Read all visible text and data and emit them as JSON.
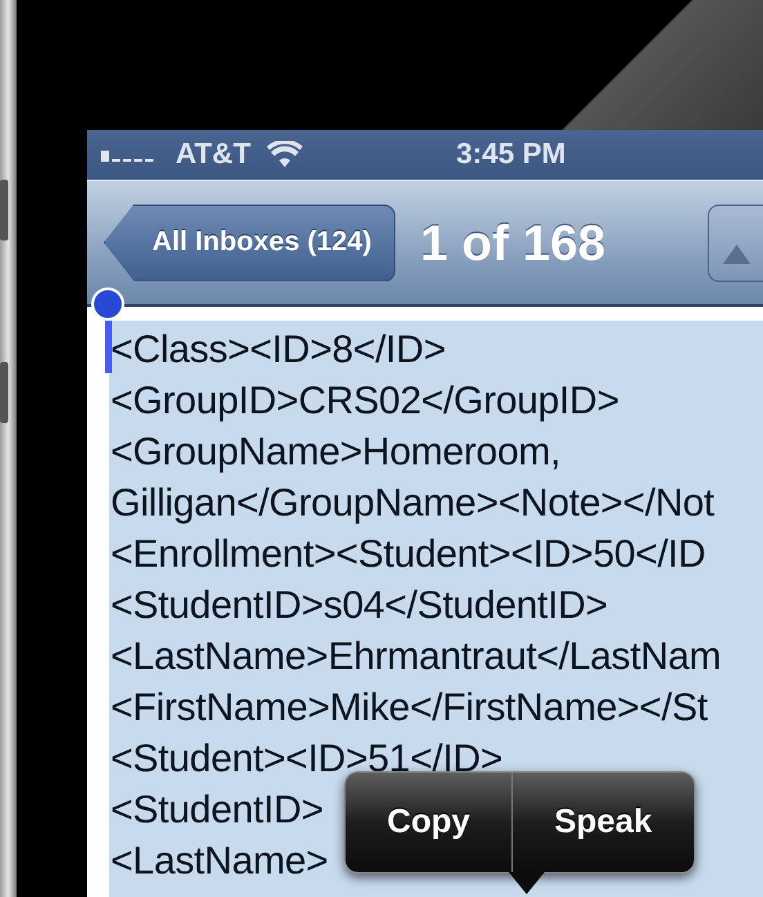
{
  "status_bar": {
    "carrier": "AT&T",
    "time": "3:45 PM"
  },
  "nav_bar": {
    "back_button": "All Inboxes (124)",
    "title": "1 of 168"
  },
  "message_lines": [
    {
      "text": "<Class><ID>8</ID>"
    },
    {
      "text": "<GroupID>CRS02</GroupID>"
    },
    {
      "text": "<GroupName>Homeroom,"
    },
    {
      "text": "Gilligan</GroupName><Note></Not"
    },
    {
      "text": "<Enrollment><Student><ID>50</ID"
    },
    {
      "text": "<StudentID>s04</StudentID>"
    },
    {
      "text": "<LastName>Ehrmantraut</LastNam"
    },
    {
      "text": "<FirstName>Mike</FirstName></St"
    },
    {
      "text": "<Student><ID>51</ID>"
    },
    {
      "text": "<StudentID>"
    },
    {
      "text": "<LastName>"
    }
  ],
  "edit_menu": [
    "Copy",
    "Speak"
  ]
}
